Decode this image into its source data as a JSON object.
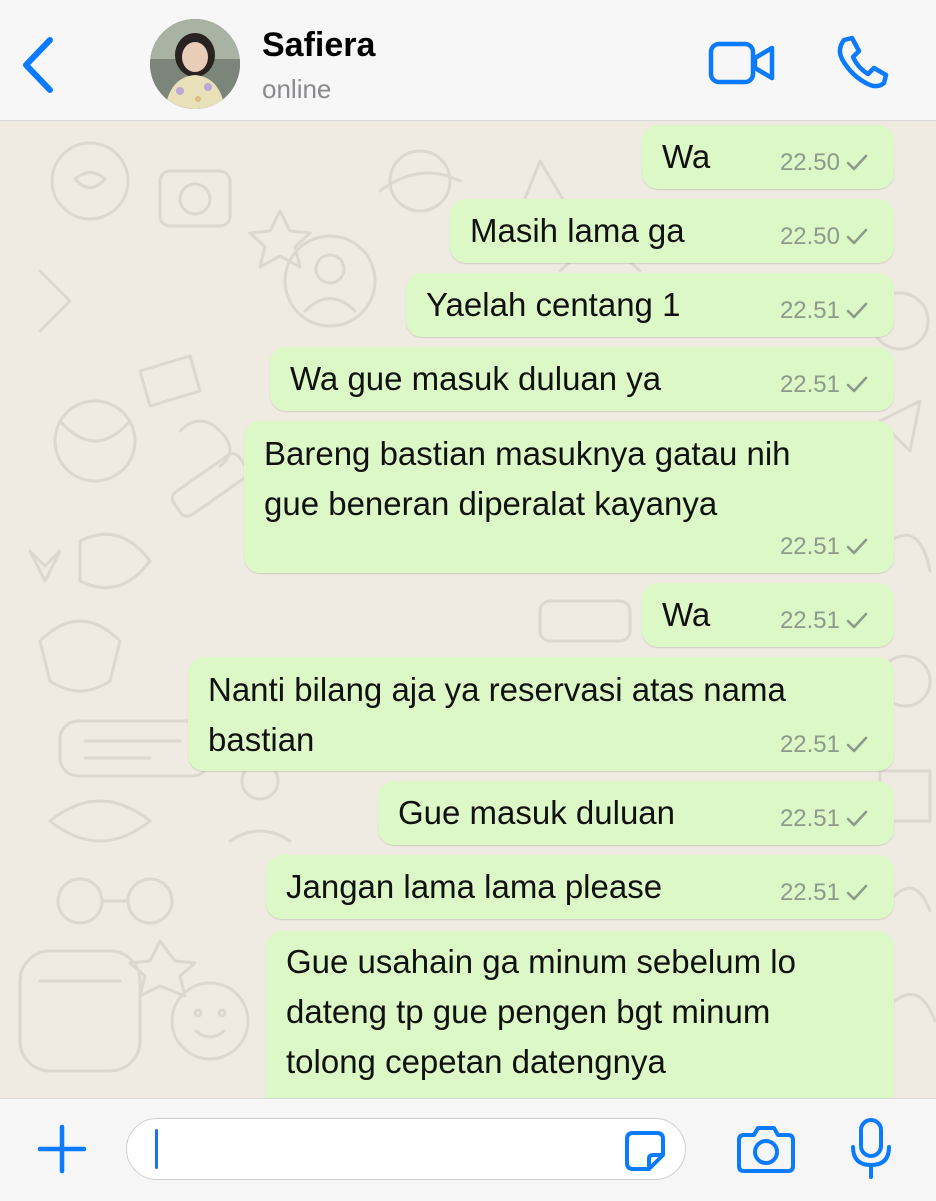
{
  "header": {
    "contact_name": "Safiera",
    "status": "online"
  },
  "messages": [
    {
      "text": "Wa",
      "time": "22.50"
    },
    {
      "text": "Masih lama ga",
      "time": "22.50"
    },
    {
      "text": "Yaelah centang 1",
      "time": "22.51"
    },
    {
      "text": "Wa gue masuk duluan ya",
      "time": "22.51"
    },
    {
      "text": "Bareng bastian masuknya gatau nih\ngue beneran diperalat kayanya",
      "time": "22.51"
    },
    {
      "text": "Wa",
      "time": "22.51"
    },
    {
      "text": "Nanti bilang aja ya reservasi atas nama\nbastian",
      "time": "22.51"
    },
    {
      "text": "Gue masuk duluan",
      "time": "22.51"
    },
    {
      "text": "Jangan lama lama please",
      "time": "22.51"
    },
    {
      "text": "Gue usahain ga minum sebelum lo\ndateng tp gue pengen bgt minum\ntolong cepetan datengnya",
      "time": ""
    }
  ],
  "input": {
    "value": ""
  },
  "colors": {
    "accent": "#0a7aff",
    "bubble_out": "#dcf8c6",
    "wallpaper": "#efeae2"
  },
  "icons": [
    "back-chevron-icon",
    "video-call-icon",
    "phone-icon",
    "plus-icon",
    "sticker-icon",
    "camera-icon",
    "microphone-icon",
    "single-check-icon"
  ]
}
